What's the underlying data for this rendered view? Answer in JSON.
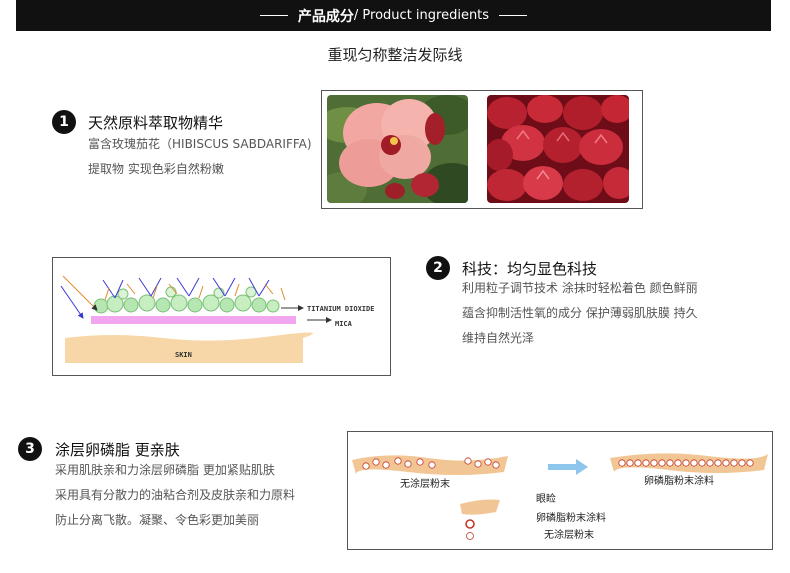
{
  "header": {
    "title_cn": "产品成分",
    "title_en": " / Product ingredients"
  },
  "subtitle": "重现匀称整洁发际线",
  "section1": {
    "number": "1",
    "title": "天然原料萃取物精华",
    "lines": [
      "富含玫瑰茄花（HIBISCUS SABDARIFFA)",
      "提取物 实现色彩自然粉嫩"
    ]
  },
  "section2": {
    "number": "2",
    "title": "科技：均匀显色科技",
    "lines": [
      "利用粒子调节技术 涂抹时轻松着色 颜色鲜丽",
      "蕴含抑制活性氧的成分 保护薄弱肌肤膜 持久",
      "维持自然光泽"
    ],
    "diagram": {
      "label_titanium": "TITANIUM DIOXIDE",
      "label_mica": "MICA",
      "label_skin": "SKIN"
    }
  },
  "section3": {
    "number": "3",
    "title": "涂层卵磷脂 更亲肤",
    "lines": [
      "采用肌肤亲和力涂层卵磷脂 更加紧贴肌肤",
      "采用具有分散力的油粘合剂及皮肤亲和力原料",
      "防止分离飞散。凝聚、令色彩更加美丽"
    ],
    "diagram": {
      "left_label": "无涂层粉末",
      "right_label": "卵磷脂粉末涂料",
      "legend_title": "眼睑",
      "legend_item1": "卵磷脂粉末涂料",
      "legend_item2": "无涂层粉末"
    }
  }
}
